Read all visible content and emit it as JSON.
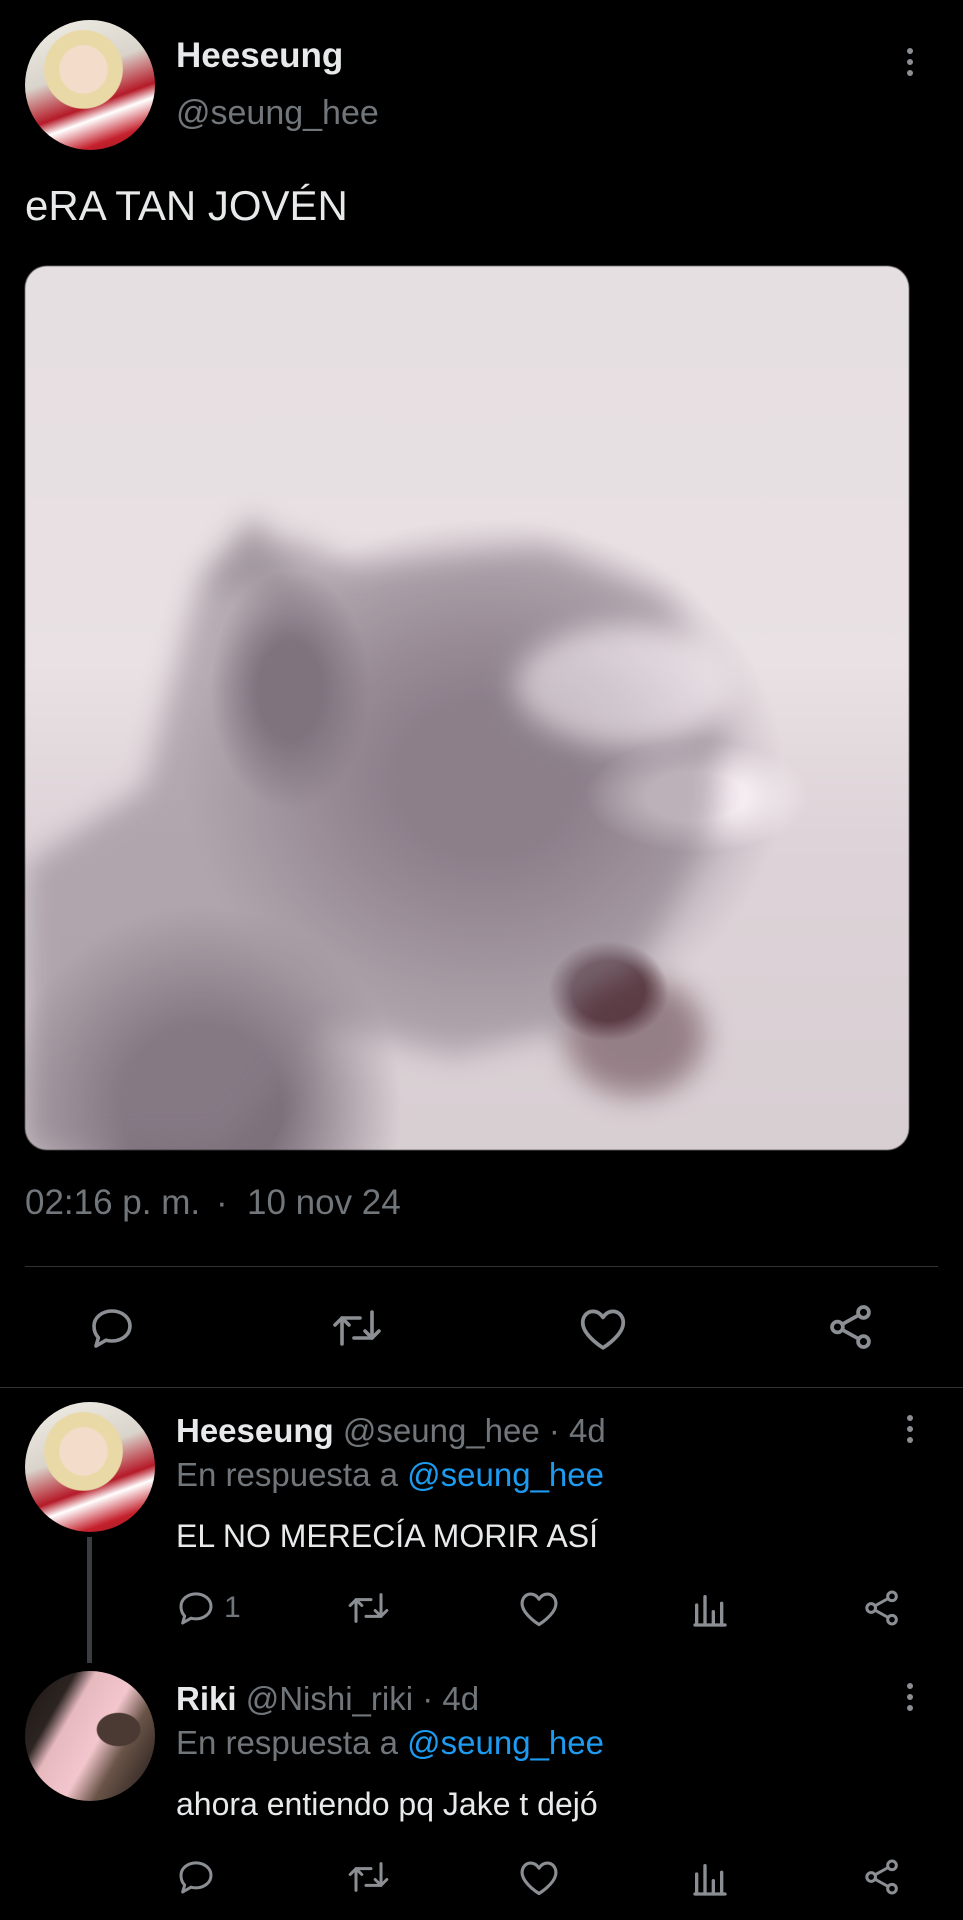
{
  "main_tweet": {
    "display_name": "Heeseung",
    "handle": "@seung_hee",
    "text": "eRA TAN JOVÉN",
    "time": "02:16 p. m.",
    "separator": "·",
    "date": "10 nov 24",
    "media_alt": "blurred yelling cat photo"
  },
  "replies": [
    {
      "display_name": "Heeseung",
      "handle": "@seung_hee",
      "age": "· 4d",
      "reply_prefix": "En respuesta a",
      "reply_to": "@seung_hee",
      "text": "EL NO MERECÍA MORIR ASÍ",
      "reply_count": "1"
    },
    {
      "display_name": "Riki",
      "handle": "@Nishi_riki",
      "age": "· 4d",
      "reply_prefix": "En respuesta a",
      "reply_to": "@seung_hee",
      "text": "ahora entiendo pq Jake t dejó",
      "reply_count": ""
    }
  ],
  "icons": [
    "more-icon",
    "reply-icon",
    "retweet-icon",
    "like-icon",
    "share-icon",
    "views-icon"
  ],
  "colors": {
    "background": "#000000",
    "text": "#e7e9ea",
    "muted": "#71767b",
    "link": "#1d9bf0",
    "divider": "#2f3336"
  }
}
